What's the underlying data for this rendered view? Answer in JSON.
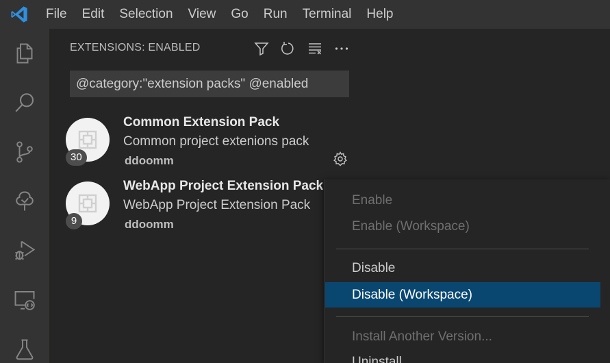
{
  "menubar": {
    "items": [
      "File",
      "Edit",
      "Selection",
      "View",
      "Go",
      "Run",
      "Terminal",
      "Help"
    ]
  },
  "activitybar": {
    "icons": [
      "files-icon",
      "search-icon",
      "source-control-icon",
      "tree-icon",
      "run-debug-icon",
      "remote-explorer-icon",
      "testing-icon"
    ]
  },
  "sidebar": {
    "title": "EXTENSIONS: ENABLED",
    "actions": [
      "filter-icon",
      "refresh-icon",
      "clear-icon",
      "more-icon"
    ],
    "search": {
      "value": "@category:\"extension packs\" @enabled"
    },
    "extensions": [
      {
        "name": "Common Extension Pack",
        "description": "Common project extenions pack",
        "publisher": "ddoomm",
        "badge": "30"
      },
      {
        "name": "WebApp Project Extension Pack",
        "description": "WebApp Project Extension Pack",
        "publisher": "ddoomm",
        "badge": "9"
      }
    ]
  },
  "context_menu": {
    "items": [
      {
        "label": "Enable",
        "state": "disabled"
      },
      {
        "label": "Enable (Workspace)",
        "state": "disabled"
      },
      {
        "label": "Disable",
        "state": "enabled"
      },
      {
        "label": "Disable (Workspace)",
        "state": "selected"
      },
      {
        "label": "Install Another Version...",
        "state": "disabled"
      },
      {
        "label": "Uninstall",
        "state": "enabled"
      }
    ]
  },
  "colors": {
    "accent": "#0078d4",
    "selection": "#094771",
    "background": "#252526",
    "activitybar": "#333333"
  }
}
